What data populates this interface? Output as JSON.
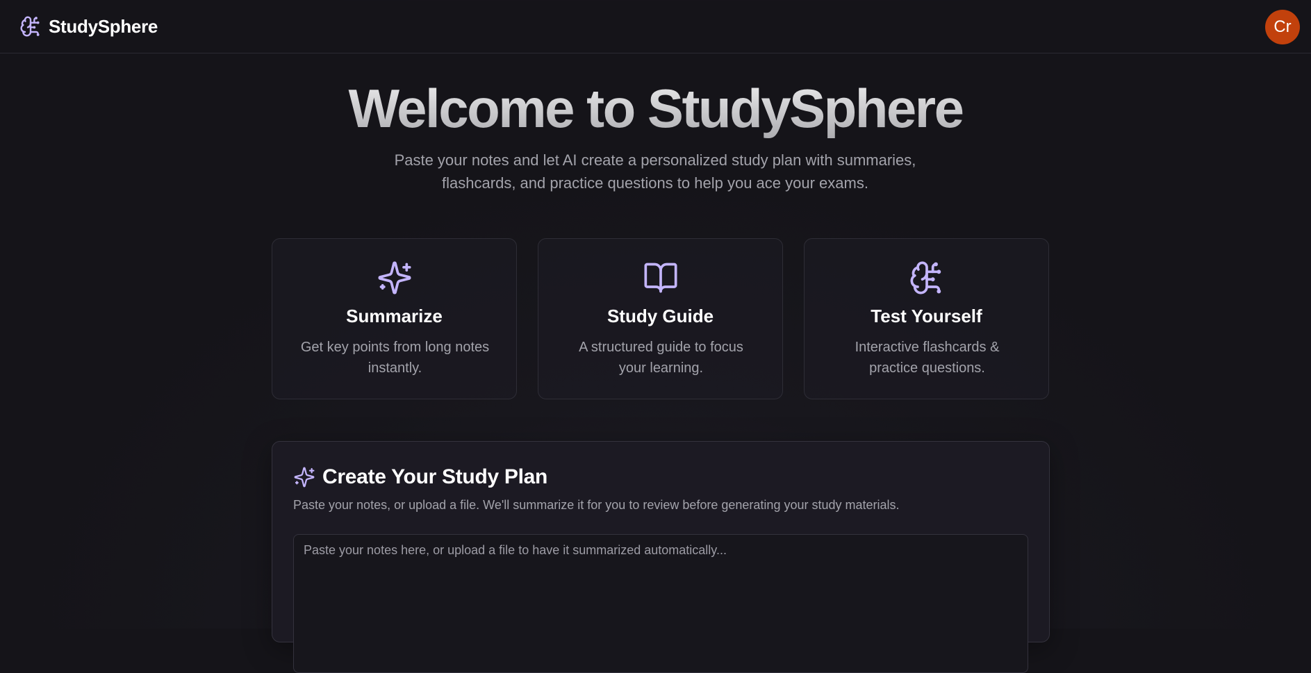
{
  "header": {
    "brand_name": "StudySphere",
    "brand_icon": "brain-icon",
    "avatar_initials": "Cr",
    "avatar_color": "#c2410c"
  },
  "hero": {
    "title": "Welcome to StudySphere",
    "subtitle_line1": "Paste your notes and let AI create a personalized study plan with summaries,",
    "subtitle_line2": "flashcards, and practice questions to help you ace your exams."
  },
  "features": [
    {
      "icon": "sparkles-icon",
      "title": "Summarize",
      "desc_line1": "Get key points from long notes",
      "desc_line2": "instantly."
    },
    {
      "icon": "book-open-icon",
      "title": "Study Guide",
      "desc_line1": "A structured guide to focus",
      "desc_line2": "your learning."
    },
    {
      "icon": "brain-icon",
      "title": "Test Yourself",
      "desc_line1": "Interactive flashcards &",
      "desc_line2": "practice questions."
    }
  ],
  "study_plan": {
    "title": "Create Your Study Plan",
    "icon": "sparkles-icon",
    "description": "Paste your notes, or upload a file. We'll summarize it for you to review before generating your study materials.",
    "notes_placeholder": "Paste your notes here, or upload a file to have it summarized automatically...",
    "notes_value": ""
  },
  "colors": {
    "accent": "#c4b5fd",
    "background": "#16151b",
    "card_border": "#2e2d36"
  }
}
